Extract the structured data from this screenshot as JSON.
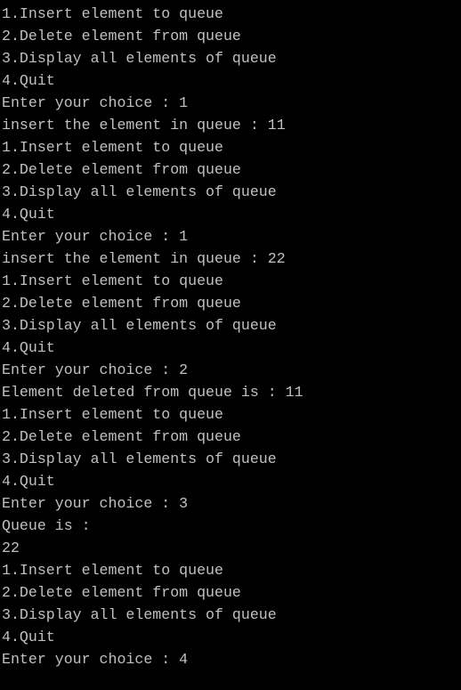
{
  "console": {
    "lines": [
      "1.Insert element to queue",
      "2.Delete element from queue",
      "3.Display all elements of queue",
      "4.Quit",
      "Enter your choice : 1",
      "insert the element in queue : 11",
      "1.Insert element to queue",
      "2.Delete element from queue",
      "3.Display all elements of queue",
      "4.Quit",
      "Enter your choice : 1",
      "insert the element in queue : 22",
      "1.Insert element to queue",
      "2.Delete element from queue",
      "3.Display all elements of queue",
      "4.Quit",
      "Enter your choice : 2",
      "Element deleted from queue is : 11",
      "1.Insert element to queue",
      "2.Delete element from queue",
      "3.Display all elements of queue",
      "4.Quit",
      "Enter your choice : 3",
      "Queue is :",
      "22",
      "1.Insert element to queue",
      "2.Delete element from queue",
      "3.Display all elements of queue",
      "4.Quit",
      "Enter your choice : 4"
    ]
  },
  "colors": {
    "background": "#000000",
    "text": "#c0c0c0"
  }
}
